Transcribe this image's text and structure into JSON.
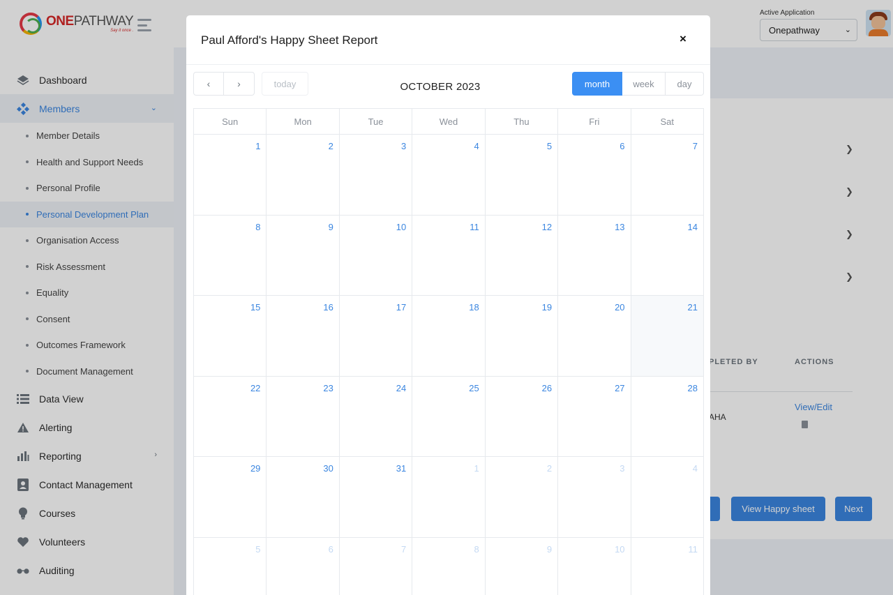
{
  "brand": {
    "name_one": "ONE",
    "name_rest": "PATHWAY",
    "tagline": "Say it once ."
  },
  "sidebar": {
    "items": [
      {
        "label": "Dashboard",
        "icon": "layers-icon"
      },
      {
        "label": "Members",
        "icon": "members-icon",
        "active": true,
        "expanded": true
      },
      {
        "label": "Data View",
        "icon": "list-icon"
      },
      {
        "label": "Alerting",
        "icon": "warning-icon"
      },
      {
        "label": "Reporting",
        "icon": "bar-chart-icon"
      },
      {
        "label": "Contact Management",
        "icon": "contact-card-icon"
      },
      {
        "label": "Courses",
        "icon": "lightbulb-icon"
      },
      {
        "label": "Volunteers",
        "icon": "heart-icon"
      },
      {
        "label": "Auditing",
        "icon": "glasses-icon"
      }
    ],
    "members_sub": [
      "Member Details",
      "Health and Support Needs",
      "Personal Profile",
      "Personal Development Plan",
      "Organisation Access",
      "Risk Assessment",
      "Equality",
      "Consent",
      "Outcomes Framework",
      "Document Management"
    ],
    "active_sub": "Personal Development Plan"
  },
  "topbar": {
    "active_app_label": "Active Application",
    "active_app_value": "Onepathway"
  },
  "background": {
    "col_completed_by": "PLETED BY",
    "col_actions": "ACTIONS",
    "row_completed_by": "AHA",
    "row_action": "View/Edit",
    "btn_view_happy_sheet": "View Happy sheet",
    "btn_next": "Next"
  },
  "modal": {
    "title": "Paul Afford's Happy Sheet Report",
    "close": "×",
    "calendar": {
      "title": "OCTOBER 2023",
      "prev": "‹",
      "next": "›",
      "today": "today",
      "views": {
        "month": "month",
        "week": "week",
        "day": "day"
      },
      "active_view": "month",
      "weekdays": [
        "Sun",
        "Mon",
        "Tue",
        "Wed",
        "Thu",
        "Fri",
        "Sat"
      ],
      "weeks": [
        [
          "1",
          "2",
          "3",
          "4",
          "5",
          "6",
          "7"
        ],
        [
          "8",
          "9",
          "10",
          "11",
          "12",
          "13",
          "14"
        ],
        [
          "15",
          "16",
          "17",
          "18",
          "19",
          "20",
          "21"
        ],
        [
          "22",
          "23",
          "24",
          "25",
          "26",
          "27",
          "28"
        ],
        [
          "29",
          "30",
          "31",
          "1",
          "2",
          "3",
          "4"
        ],
        [
          "5",
          "6",
          "7",
          "8",
          "9",
          "10",
          "11"
        ]
      ],
      "highlighted_day": "21"
    }
  },
  "colors": {
    "accent": "#3b86e0",
    "month_button": "#3b8ff3",
    "brand_red": "#d62828"
  }
}
